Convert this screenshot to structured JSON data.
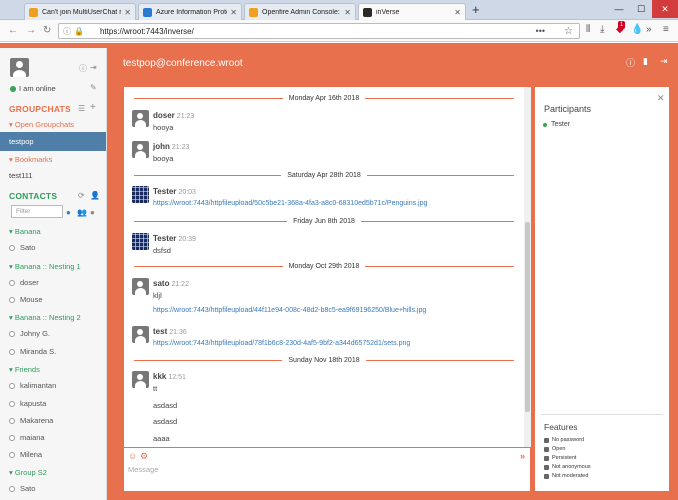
{
  "browser": {
    "tabs": [
      {
        "label": "Can't join MultiUserChat remo",
        "color": "#f0a020",
        "active": false
      },
      {
        "label": "Azure Information Protection I",
        "color": "#2a7bd0",
        "active": false
      },
      {
        "label": "Openfire Admin Console: inVer",
        "color": "#f0a020",
        "active": false
      },
      {
        "label": "inVerse",
        "color": "#2a2a2a",
        "active": true
      }
    ],
    "new_tab": "+",
    "url": "https://wroot:7443/inverse/",
    "url_dots": "•••",
    "badge": "1",
    "window_buttons": {
      "minimize": "—",
      "maximize": "☐",
      "close": "✕"
    }
  },
  "sidebar": {
    "status": "I am online",
    "groupchats_heading": "GROUPCHATS",
    "open_groupchats": "▾ Open Groupchats",
    "rooms_open": [
      "testpop"
    ],
    "bookmarks": "▾ Bookmarks",
    "rooms_bookmarked": [
      "test111"
    ],
    "contacts_heading": "CONTACTS",
    "filter_placeholder": "Filter",
    "groups": [
      {
        "name": "▾ Banana",
        "contacts": [
          "Sato"
        ]
      },
      {
        "name": "▾ Banana :: Nesting 1",
        "contacts": [
          "doser",
          "Mouse"
        ]
      },
      {
        "name": "▾ Banana :: Nesting 2",
        "contacts": [
          "Johny G.",
          "Miranda S."
        ]
      },
      {
        "name": "▾ Friends",
        "contacts": [
          "kalimantan",
          "kapusta",
          "Makarena",
          "maiana",
          "Milena"
        ]
      },
      {
        "name": "▾ Group S2",
        "contacts": [
          "Sato"
        ]
      }
    ]
  },
  "chat": {
    "title": "testpop@conference.wroot",
    "messages": {
      "d1": "Monday Apr 16th 2018",
      "m1": {
        "name": "doser",
        "time": "21:23",
        "text": "hooya"
      },
      "m2": {
        "name": "john",
        "time": "21:23",
        "text": "booya"
      },
      "d2": "Saturday Apr 28th 2018",
      "m3": {
        "name": "Tester",
        "time": "20:03",
        "text": "https://wroot:7443/httpfileupload/50c5be21-368a-4fa3-a8c0-68310ed5b71c/Penguins.jpg"
      },
      "d3": "Friday Jun 8th 2018",
      "m4": {
        "name": "Tester",
        "time": "20:39",
        "text": "dsfsd"
      },
      "d4": "Monday Oct 29th 2018",
      "m5": {
        "name": "sato",
        "time": "21:22",
        "text": "kljl",
        "link": "https://wroot:7443/httpfileupload/44f11e94-008c-48d2-b8c5-ea9f69196250/Blue+hills.jpg"
      },
      "m6": {
        "name": "test",
        "time": "21:36",
        "text": "https://wroot:7443/httpfileupload/78f1b6c8-230d-4af5-9bf2-a344d65752d1/sets.png"
      },
      "d5": "Sunday Nov 18th 2018",
      "m7": {
        "name": "kkk",
        "time": "12:51",
        "text": "tt",
        "lines": [
          "asdasd",
          "asdasd",
          "aaaa"
        ]
      }
    },
    "compose_placeholder": "Message",
    "emoji_icon": "☺",
    "send_icon": "»"
  },
  "participants": {
    "title": "Participants",
    "list": [
      "Tester"
    ],
    "features_title": "Features",
    "features": [
      "No password",
      "Open",
      "Persistent",
      "Not anonymous",
      "Not moderated"
    ]
  },
  "colors": {
    "accent": "#e8704c",
    "online": "#3aa35b",
    "active_room": "#4f7fa8"
  }
}
